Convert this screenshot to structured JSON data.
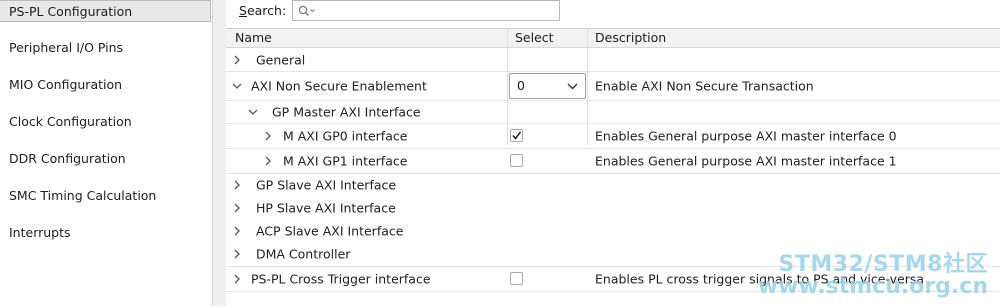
{
  "sidebar": {
    "items": [
      {
        "label": "PS-PL Configuration",
        "selected": true
      },
      {
        "label": "Peripheral I/O Pins",
        "selected": false
      },
      {
        "label": "MIO Configuration",
        "selected": false
      },
      {
        "label": "Clock Configuration",
        "selected": false
      },
      {
        "label": "DDR Configuration",
        "selected": false
      },
      {
        "label": "SMC Timing Calculation",
        "selected": false
      },
      {
        "label": "Interrupts",
        "selected": false
      }
    ]
  },
  "search": {
    "label_mnemonic": "S",
    "label_rest": "earch:",
    "value": "",
    "icon": "search-icon"
  },
  "table": {
    "columns": {
      "name": "Name",
      "select": "Select",
      "description": "Description"
    },
    "rows": [
      {
        "label": "General",
        "expanded": false,
        "select": "none",
        "description": ""
      },
      {
        "label": "AXI Non Secure Enablement",
        "expanded": true,
        "select": "dropdown",
        "select_value": "0",
        "description": "Enable AXI Non Secure Transaction"
      },
      {
        "label": "GP Master AXI Interface",
        "expanded": true,
        "select": "none",
        "description": ""
      },
      {
        "label": "M AXI GP0 interface",
        "expanded": false,
        "select": "checkbox",
        "checked": true,
        "description": "Enables General purpose AXI master interface 0"
      },
      {
        "label": "M AXI GP1 interface",
        "expanded": false,
        "select": "checkbox",
        "checked": false,
        "description": "Enables General purpose AXI master interface 1"
      },
      {
        "label": "GP Slave AXI Interface",
        "expanded": false,
        "select": "none",
        "description": ""
      },
      {
        "label": "HP Slave AXI Interface",
        "expanded": false,
        "select": "none",
        "description": ""
      },
      {
        "label": "ACP Slave AXI Interface",
        "expanded": false,
        "select": "none",
        "description": ""
      },
      {
        "label": "DMA Controller",
        "expanded": false,
        "select": "none",
        "description": ""
      },
      {
        "label": "PS-PL Cross Trigger interface",
        "expanded": false,
        "select": "checkbox",
        "checked": false,
        "description": "Enables PL cross trigger signals to PS and vice-versa"
      }
    ]
  },
  "watermark": {
    "line1": "STM32/STM8社区",
    "line2": "www.stmcu.org.cn"
  },
  "colors": {
    "selected_bg": "#e8e8e8",
    "header_bg": "#f2f2f2",
    "gutter": "#efefef"
  }
}
